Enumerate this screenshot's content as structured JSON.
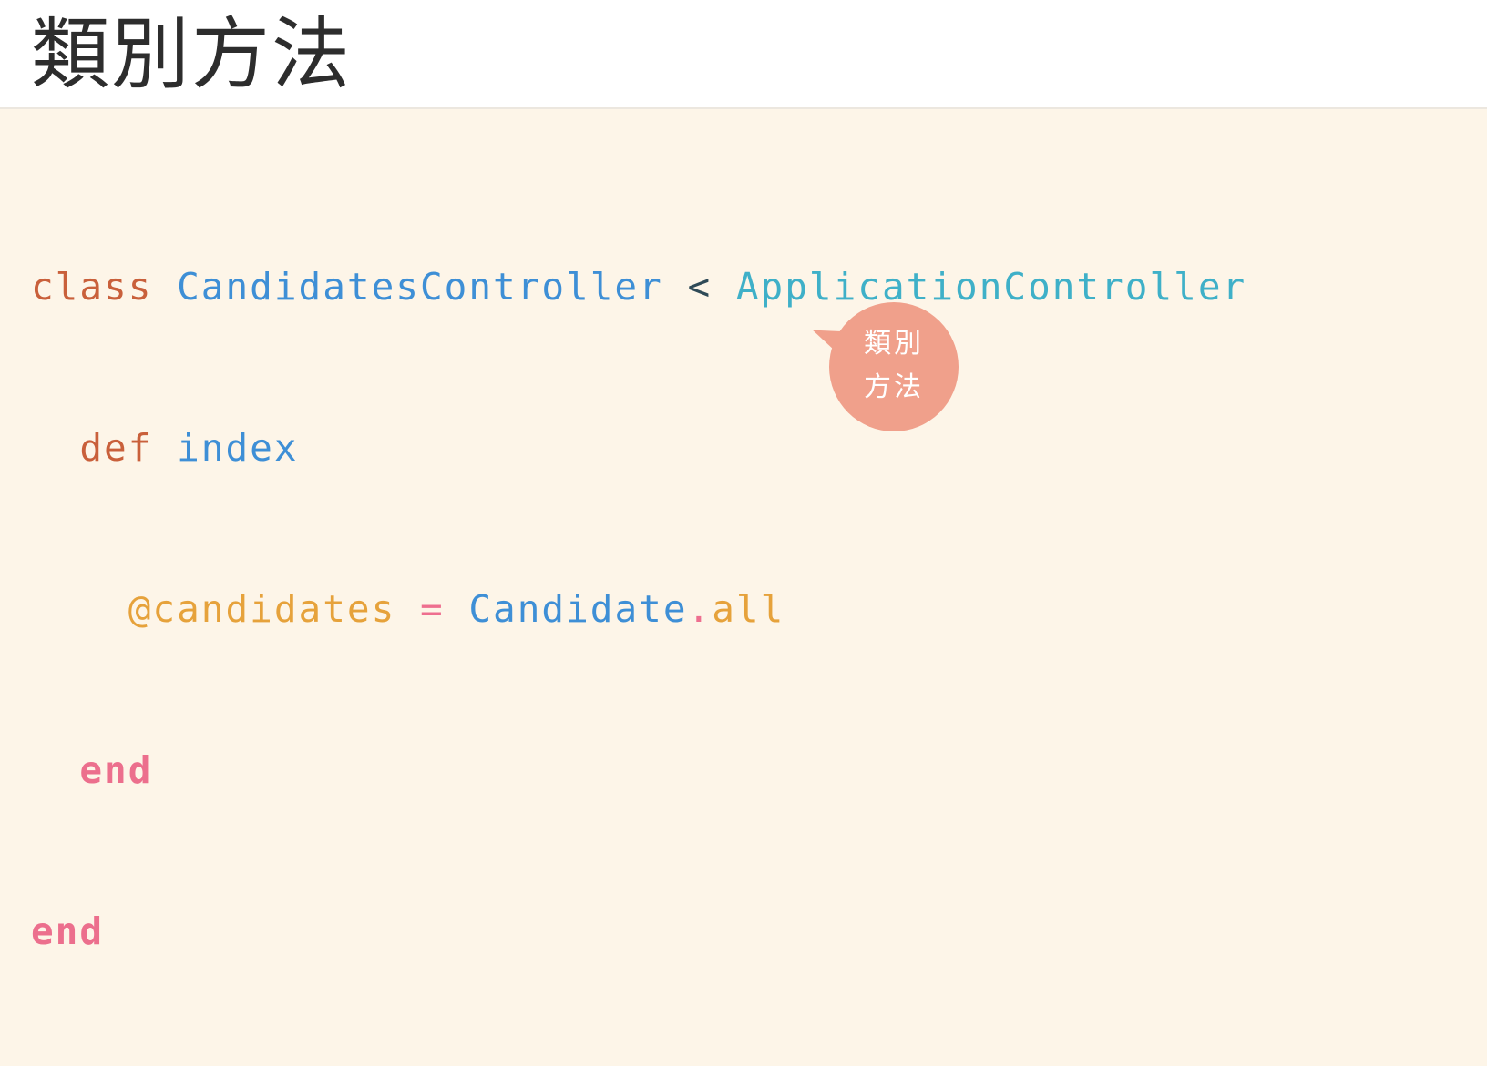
{
  "slide": {
    "title": "類別方法"
  },
  "code": {
    "line1": {
      "kw_class": "class",
      "class_name": "CandidatesController",
      "lt": "<",
      "parent": "ApplicationController"
    },
    "line2": {
      "indent": "  ",
      "kw_def": "def",
      "method": "index"
    },
    "line3": {
      "indent": "    ",
      "ivar": "@candidates",
      "eq": "=",
      "receiver": "Candidate",
      "dot": ".",
      "call": "all"
    },
    "line4": {
      "indent": "  ",
      "kw_end": "end"
    },
    "line5": {
      "kw_end": "end"
    }
  },
  "callout": {
    "line1": "類別",
    "line2": "方法"
  },
  "colors": {
    "keyword": "#c9603b",
    "class": "#3e8fd6",
    "parent_class": "#3fb0c8",
    "ivar": "#e6a23b",
    "end": "#ec6f8d",
    "bubble": "#f0a08b",
    "background": "#fdf5e8"
  }
}
